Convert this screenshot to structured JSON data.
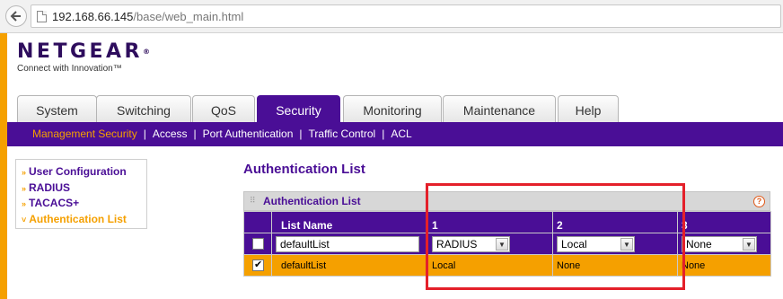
{
  "browser": {
    "url_host": "192.168.66.145",
    "url_path": "/base/web_main.html"
  },
  "brand": {
    "name": "NETGEAR",
    "trademark": "®",
    "tagline": "Connect with Innovation™"
  },
  "tabs": [
    {
      "label": "System",
      "active": false
    },
    {
      "label": "Switching",
      "active": false
    },
    {
      "label": "QoS",
      "active": false
    },
    {
      "label": "Security",
      "active": true
    },
    {
      "label": "Monitoring",
      "active": false
    },
    {
      "label": "Maintenance",
      "active": false
    },
    {
      "label": "Help",
      "active": false
    }
  ],
  "subnav": [
    {
      "label": "Management Security",
      "active": true
    },
    {
      "label": "Access",
      "active": false
    },
    {
      "label": "Port Authentication",
      "active": false
    },
    {
      "label": "Traffic Control",
      "active": false
    },
    {
      "label": "ACL",
      "active": false
    }
  ],
  "side_menu": [
    {
      "label": "User Configuration",
      "active": false
    },
    {
      "label": "RADIUS",
      "active": false
    },
    {
      "label": "TACACS+",
      "active": false
    },
    {
      "label": "Authentication List",
      "active": true
    }
  ],
  "page_title": "Authentication List",
  "panel": {
    "title": "Authentication List",
    "help_glyph": "?",
    "columns": [
      "",
      "List Name",
      "1",
      "2",
      "3"
    ],
    "edit_row": {
      "checked": false,
      "list_name": "defaultList",
      "method1": "RADIUS",
      "method2": "Local",
      "method3": "None"
    },
    "rows": [
      {
        "checked": true,
        "list_name": "defaultList",
        "method1": "Local",
        "method2": "None",
        "method3": "None"
      }
    ]
  },
  "colors": {
    "purple": "#4a0e96",
    "orange": "#f5a000",
    "highlight_red": "#e4202a"
  }
}
